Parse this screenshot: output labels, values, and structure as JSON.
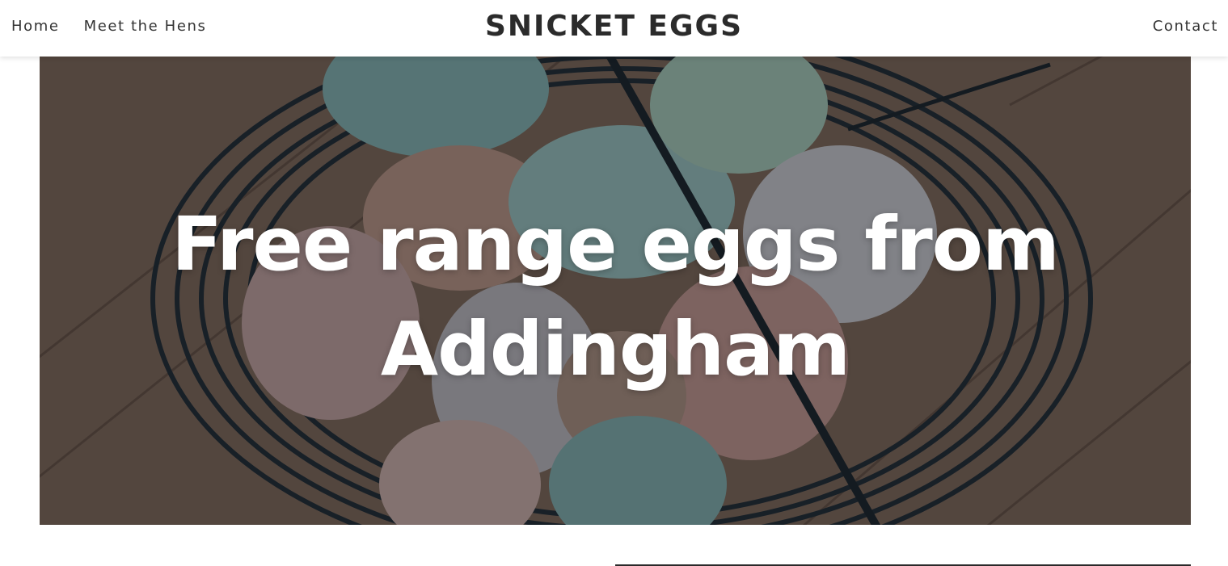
{
  "header": {
    "brand": "SNICKET EGGS",
    "nav_left": [
      {
        "label": "Home"
      },
      {
        "label": "Meet the Hens"
      }
    ],
    "nav_right": {
      "label": "Contact"
    }
  },
  "hero": {
    "title_line1": "Free range eggs from",
    "title_line2": "Addingham"
  },
  "colors": {
    "header_bg": "#ffffff",
    "brand_text": "#2b2b2b",
    "nav_text": "#333333",
    "hero_text": "#ffffff"
  }
}
